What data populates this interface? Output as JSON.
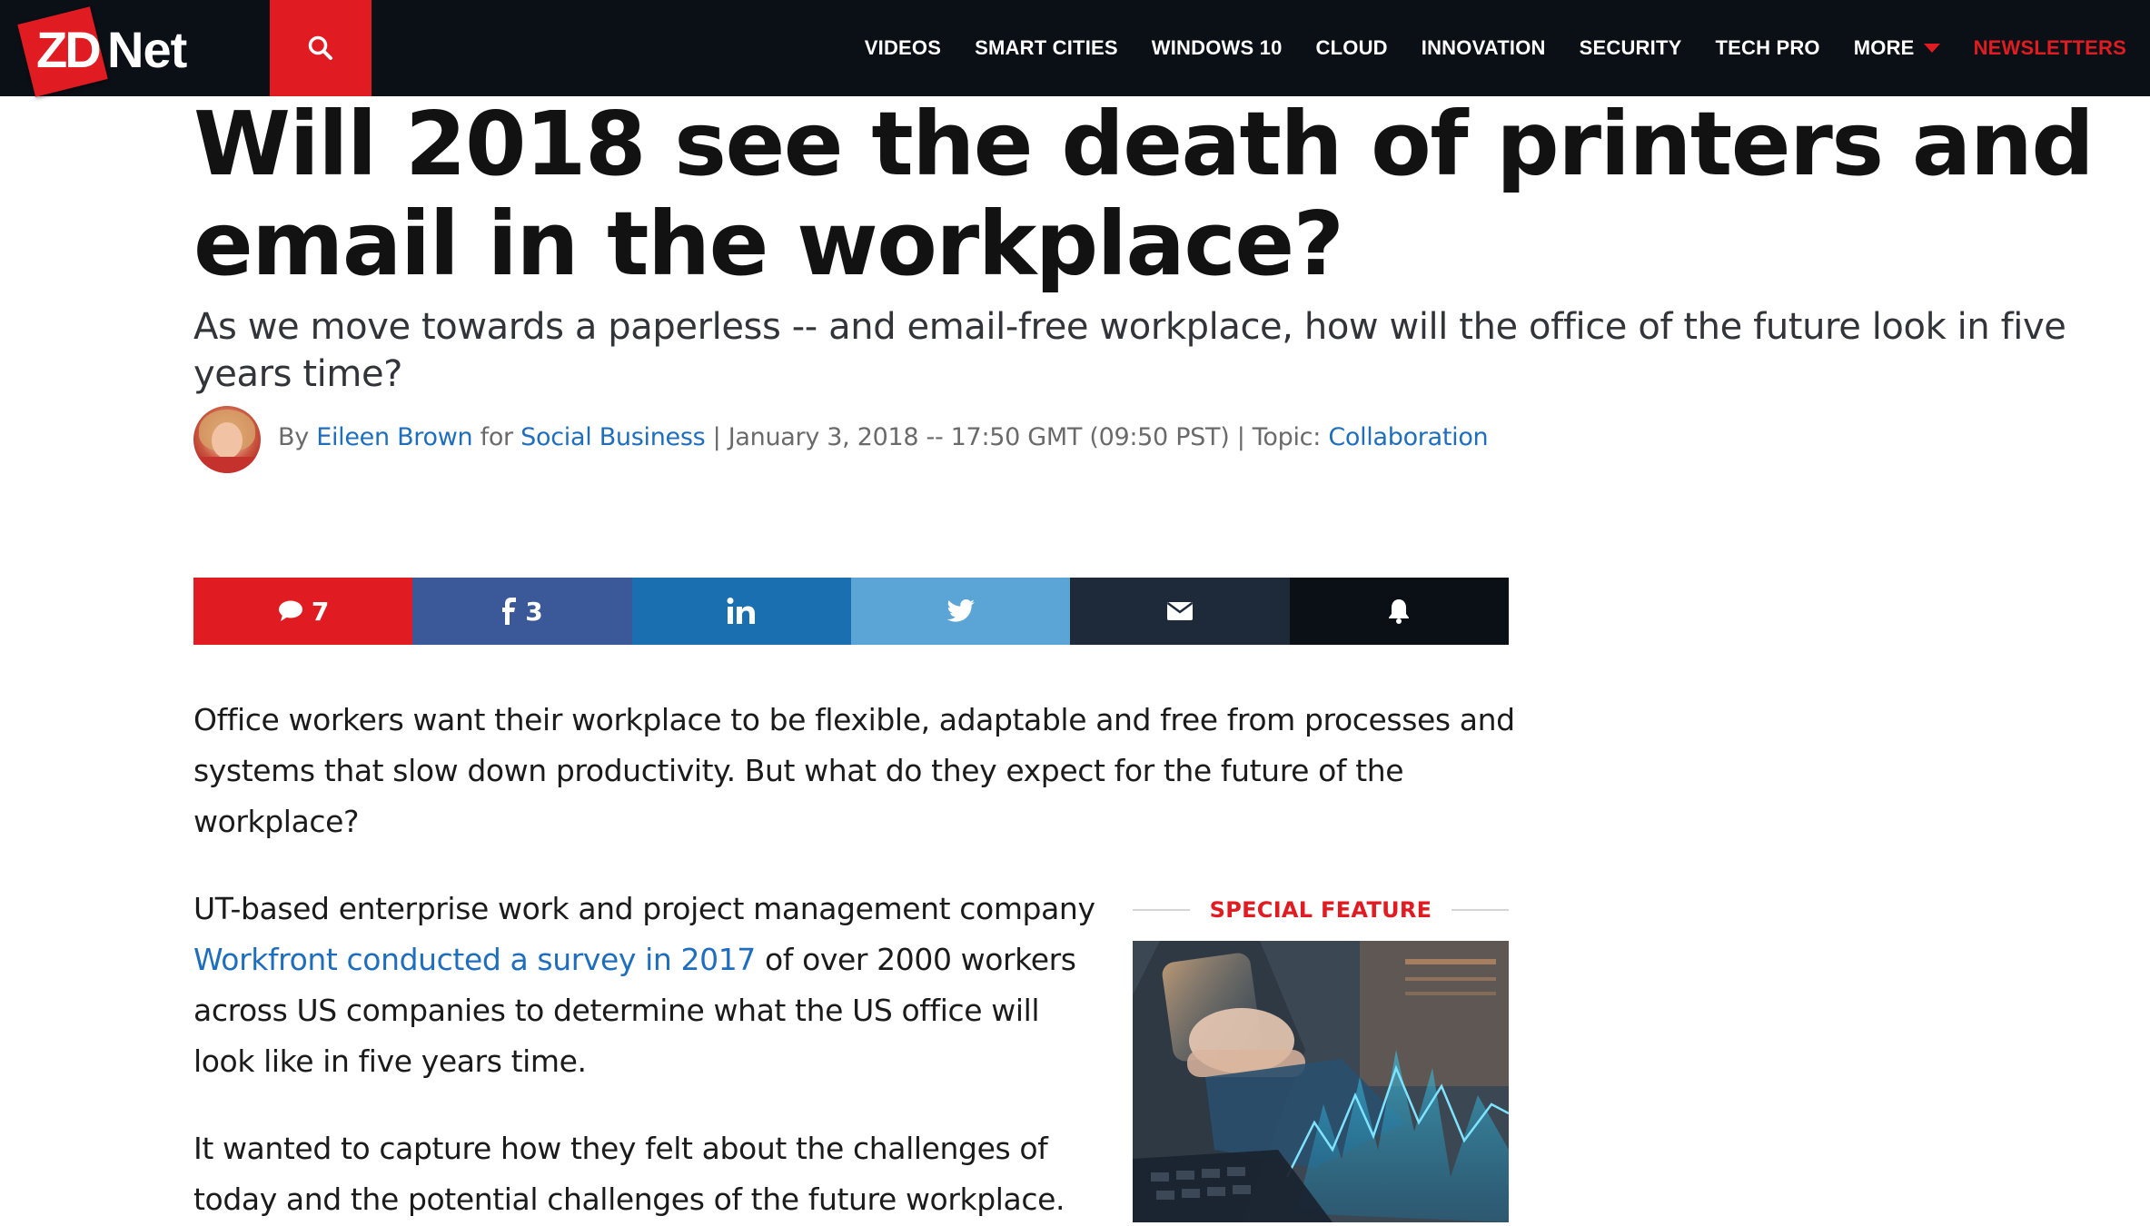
{
  "site": {
    "logo_zd": "ZD",
    "logo_net": "Net"
  },
  "nav": {
    "items": [
      "VIDEOS",
      "SMART CITIES",
      "WINDOWS 10",
      "CLOUD",
      "INNOVATION",
      "SECURITY",
      "TECH PRO",
      "MORE"
    ],
    "newsletters": "NEWSLETTERS"
  },
  "article": {
    "headline": "Will 2018 see the death of printers and email in the workplace?",
    "subhead": "As we move towards a paperless -- and email-free workplace, how will the office of the future look in five years time?",
    "byline": {
      "by": "By",
      "author": "Eileen Brown",
      "for": "for",
      "blog": "Social Business",
      "date": "| January 3, 2018 -- 17:50 GMT (09:50 PST) | Topic:",
      "topic": "Collaboration"
    },
    "share": {
      "comments_count": "7",
      "facebook_count": "3"
    },
    "paragraphs": {
      "p1": "Office workers want their workplace to be flexible, adaptable and free from processes and systems that slow down productivity. But what do they expect for the future of the workplace?",
      "p2_before": "UT-based enterprise work and project management company",
      "p2_link": "Workfront conducted a survey in 2017",
      "p2_after": "of over 2000 workers across US companies to determine what the US office will look like in five years time.",
      "p3": "It wanted to capture how they felt about the challenges of today and the potential challenges of the future workplace."
    }
  },
  "special_feature": {
    "label": "SPECIAL FEATURE"
  },
  "colors": {
    "brand_red": "#e11b22",
    "nav_bg": "#0b1016",
    "link_blue": "#1f6ebe",
    "facebook": "#3b5998",
    "linkedin": "#1a6fb0",
    "twitter": "#5ba4d6",
    "email": "#1e2a3a"
  },
  "icons": [
    "search-icon",
    "comment-icon",
    "facebook-icon",
    "linkedin-icon",
    "twitter-icon",
    "email-icon",
    "bell-icon",
    "chevron-down-icon"
  ]
}
